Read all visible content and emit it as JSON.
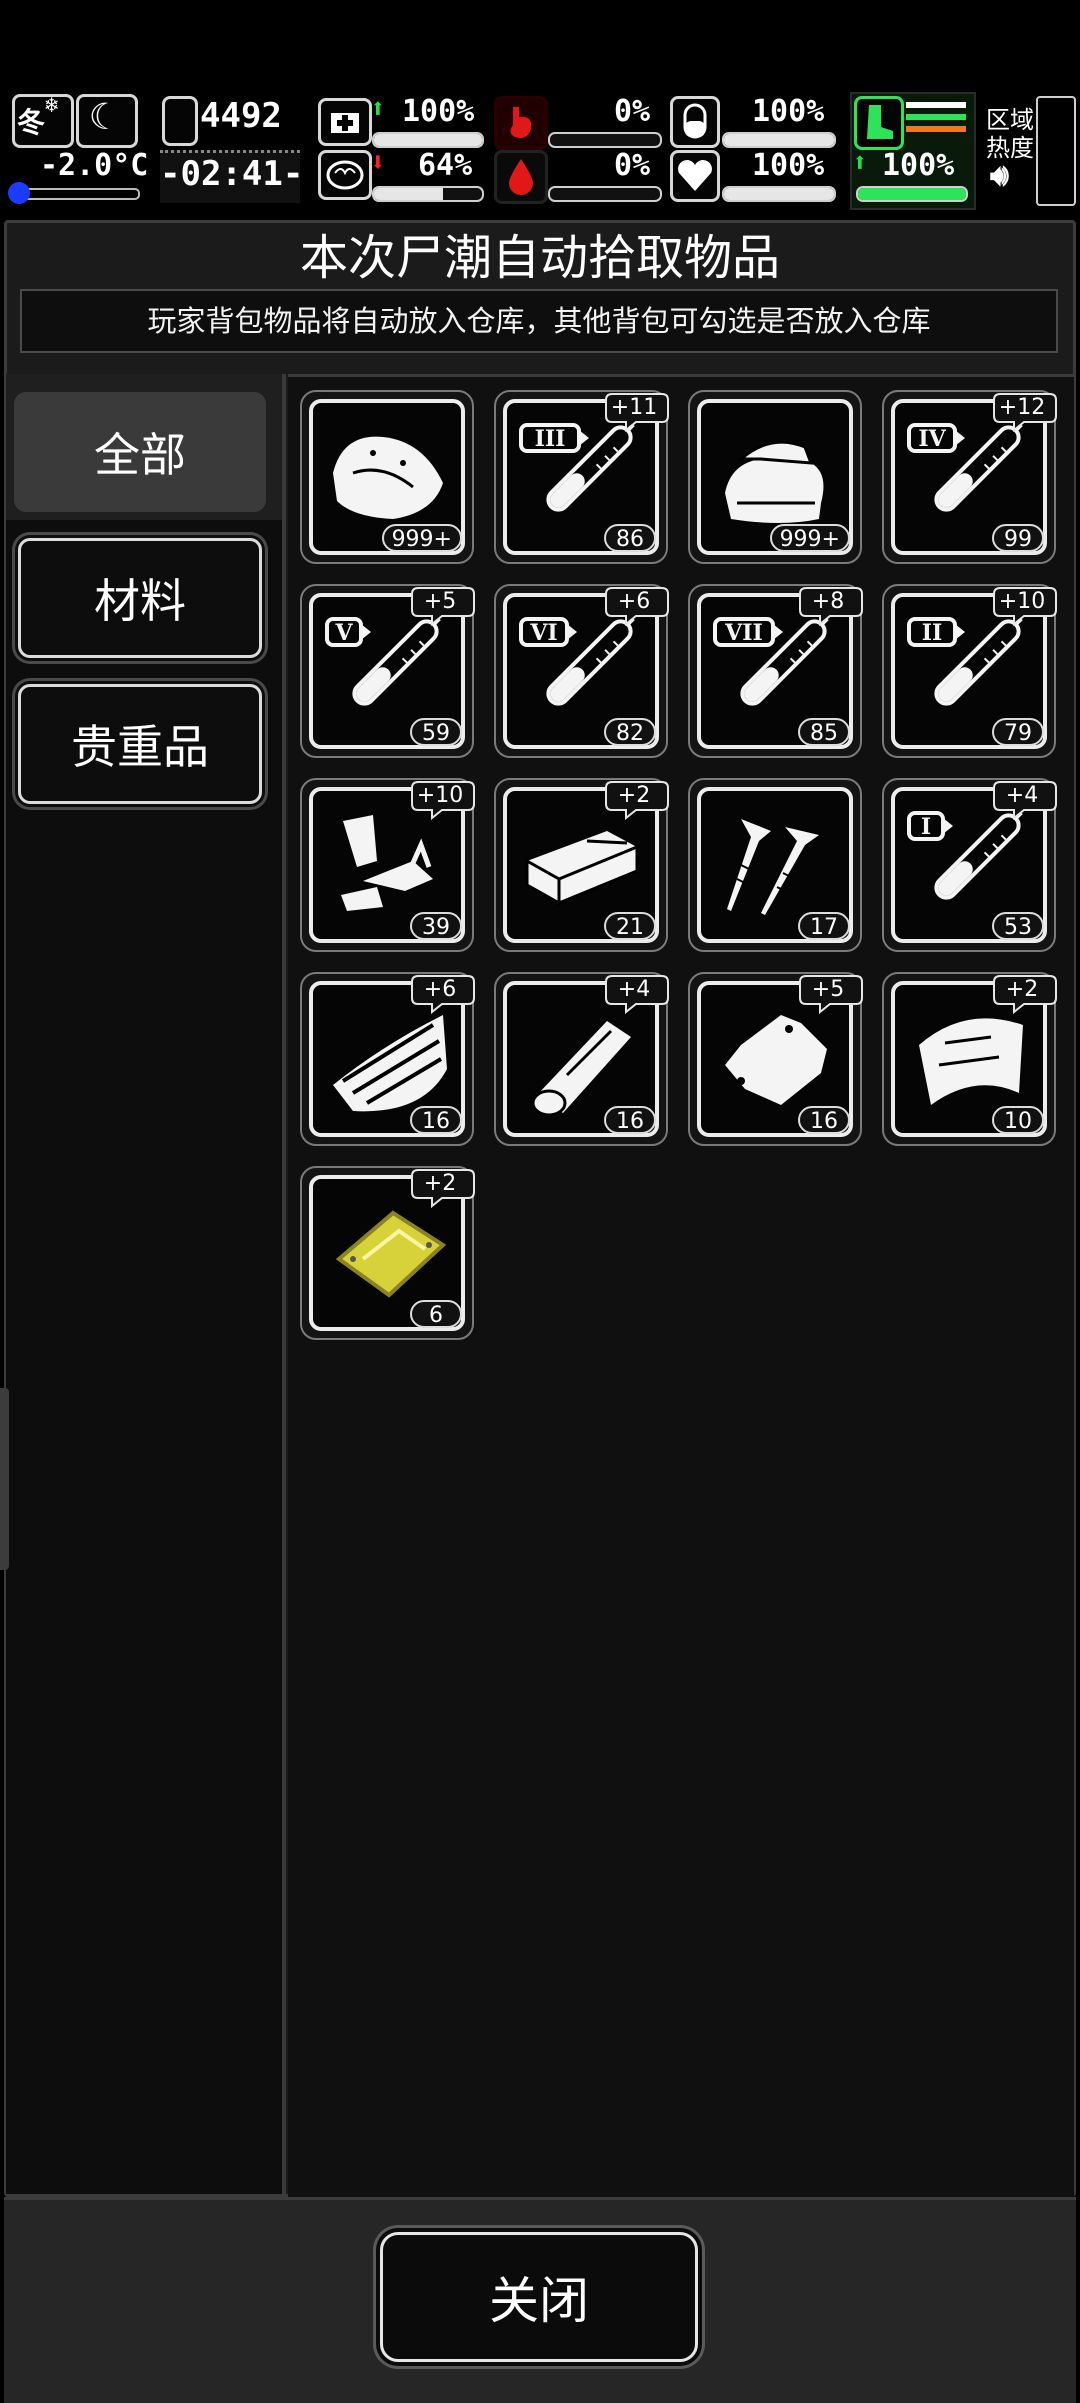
{
  "hud": {
    "season": "冬",
    "temperature": "-2.0°C",
    "day_counter": "4492",
    "clock": "-02:41-",
    "stats": [
      {
        "name": "health",
        "value": "100%",
        "trend": "up",
        "fraction": 1.0
      },
      {
        "name": "hunger",
        "value": "0%",
        "fraction": 0.0
      },
      {
        "name": "medicine",
        "value": "100%",
        "fraction": 1.0
      },
      {
        "name": "sanity",
        "value": "64%",
        "trend": "down",
        "fraction": 0.64
      },
      {
        "name": "blood",
        "value": "0%",
        "fraction": 0.0
      },
      {
        "name": "heart",
        "value": "100%",
        "fraction": 1.0
      }
    ],
    "stamina": {
      "value": "100%",
      "trend": "up",
      "fraction": 1.0
    },
    "zone_label_1": "区域",
    "zone_label_2": "热度"
  },
  "panel": {
    "title": "本次尸潮自动拾取物品",
    "subtitle": "玩家背包物品将自动放入仓库，其他背包可勾选是否放入仓库"
  },
  "categories": [
    {
      "label": "全部",
      "active": true
    },
    {
      "label": "材料",
      "active": false
    },
    {
      "label": "贵重品",
      "active": false
    }
  ],
  "items": [
    {
      "icon": "meat-icon",
      "count": "999+",
      "plus": ""
    },
    {
      "icon": "syringe-iii-icon",
      "tier": "III",
      "count": "86",
      "plus": "+11"
    },
    {
      "icon": "cloth-icon",
      "count": "999+",
      "plus": ""
    },
    {
      "icon": "syringe-iv-icon",
      "tier": "IV",
      "count": "99",
      "plus": "+12"
    },
    {
      "icon": "syringe-v-icon",
      "tier": "V",
      "count": "59",
      "plus": "+5"
    },
    {
      "icon": "syringe-vi-icon",
      "tier": "VI",
      "count": "82",
      "plus": "+6"
    },
    {
      "icon": "syringe-vii-icon",
      "tier": "VII",
      "count": "85",
      "plus": "+8"
    },
    {
      "icon": "syringe-ii-icon",
      "tier": "II",
      "count": "79",
      "plus": "+10"
    },
    {
      "icon": "scrap-metal-icon",
      "count": "39",
      "plus": "+10"
    },
    {
      "icon": "brick-icon",
      "count": "21",
      "plus": "+2"
    },
    {
      "icon": "screws-icon",
      "count": "17",
      "plus": ""
    },
    {
      "icon": "syringe-i-icon",
      "tier": "I",
      "count": "53",
      "plus": "+4"
    },
    {
      "icon": "wood-planks-icon",
      "count": "16",
      "plus": "+6"
    },
    {
      "icon": "log-icon",
      "count": "16",
      "plus": "+4"
    },
    {
      "icon": "leather-icon",
      "count": "16",
      "plus": "+5"
    },
    {
      "icon": "fabric-sheet-icon",
      "count": "10",
      "plus": "+2"
    },
    {
      "icon": "gold-plate-icon",
      "count": "6",
      "plus": "+2",
      "color": "#d8d23a"
    }
  ],
  "footer": {
    "close_label": "关闭"
  }
}
